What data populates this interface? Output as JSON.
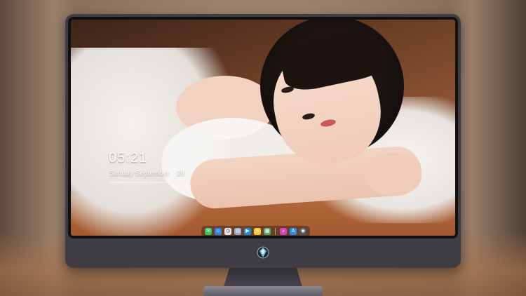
{
  "lockscreen": {
    "time": "05:21",
    "date_weekday_month": "Sunday September",
    "date_day": "28",
    "quote": "Pillow sleep forever, I never tire of the warm hour"
  },
  "dock": {
    "items": [
      {
        "name": "messages",
        "icon": "message-icon",
        "glyph": "✉",
        "color": "#35c759"
      },
      {
        "name": "finder",
        "icon": "finder-icon",
        "glyph": "☺",
        "color": "#2f86e6"
      },
      {
        "name": "clock",
        "icon": "clock-icon",
        "glyph": "◷",
        "color": "#e9e9e9"
      },
      {
        "name": "preview",
        "icon": "preview-icon",
        "glyph": "▤",
        "color": "#8fa9c7"
      },
      {
        "name": "video",
        "icon": "clapperboard-icon",
        "glyph": "▶",
        "color": "#1a8fd8"
      },
      {
        "name": "notes",
        "icon": "notes-icon",
        "glyph": "≡",
        "color": "#f5c93c"
      },
      {
        "name": "photos",
        "icon": "image-icon",
        "glyph": "▦",
        "color": "#5aa86d"
      },
      {
        "name": "music",
        "icon": "music-icon",
        "glyph": "♪",
        "color": "#d546b8"
      },
      {
        "name": "app-store",
        "icon": "app-store-icon",
        "glyph": "A",
        "color": "#2a8cf0"
      },
      {
        "name": "camera",
        "icon": "camera-icon",
        "glyph": "◉",
        "color": "#55585e"
      }
    ]
  },
  "colors": {
    "monitor_frame": "#3f3c44",
    "logo_accent": "#5fc3d8"
  }
}
